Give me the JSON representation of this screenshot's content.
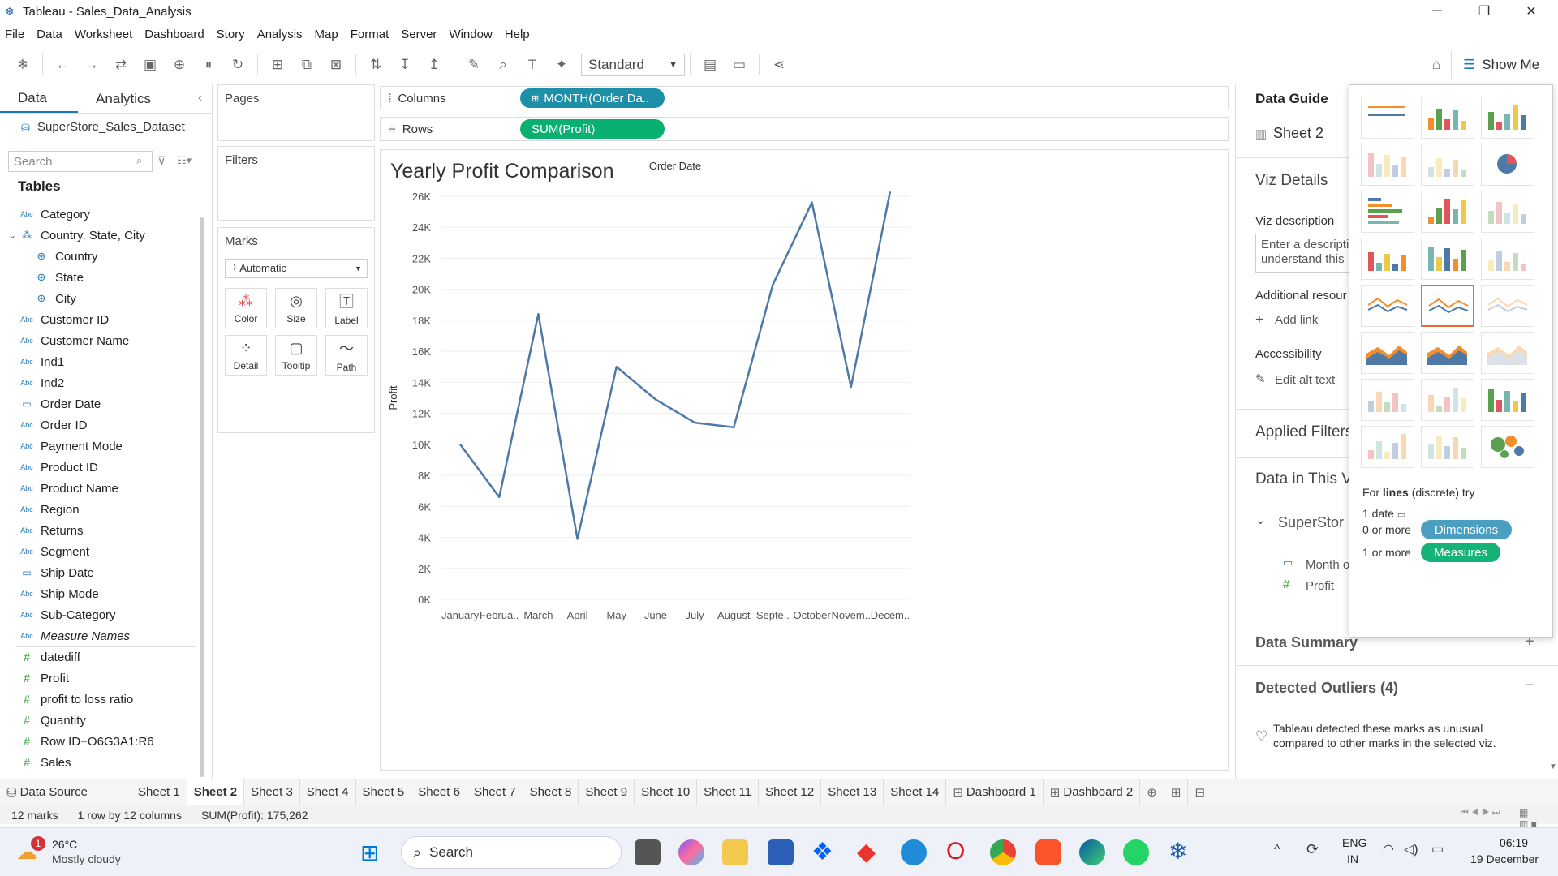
{
  "window": {
    "title": "Tableau - Sales_Data_Analysis",
    "minimize": "─",
    "maximize": "❐",
    "close": "✕"
  },
  "menu": [
    "File",
    "Data",
    "Worksheet",
    "Dashboard",
    "Story",
    "Analysis",
    "Map",
    "Format",
    "Server",
    "Window",
    "Help"
  ],
  "toolbar": {
    "fit_mode": "Standard",
    "show_me_label": "Show Me"
  },
  "data_pane": {
    "tab_data": "Data",
    "tab_analytics": "Analytics",
    "datasource": "SuperStore_Sales_Dataset",
    "search_placeholder": "Search",
    "tables_heading": "Tables",
    "fields": [
      {
        "label": "Category",
        "icon": "Abc"
      },
      {
        "label": "Country, State, City",
        "icon": "hier"
      },
      {
        "label": "Country",
        "icon": "geo"
      },
      {
        "label": "State",
        "icon": "geo"
      },
      {
        "label": "City",
        "icon": "geo"
      },
      {
        "label": "Customer ID",
        "icon": "Abc"
      },
      {
        "label": "Customer Name",
        "icon": "Abc"
      },
      {
        "label": "Ind1",
        "icon": "Abc"
      },
      {
        "label": "Ind2",
        "icon": "Abc"
      },
      {
        "label": "Order Date",
        "icon": "date"
      },
      {
        "label": "Order ID",
        "icon": "Abc"
      },
      {
        "label": "Payment Mode",
        "icon": "Abc"
      },
      {
        "label": "Product ID",
        "icon": "Abc"
      },
      {
        "label": "Product Name",
        "icon": "Abc"
      },
      {
        "label": "Region",
        "icon": "Abc"
      },
      {
        "label": "Returns",
        "icon": "Abc"
      },
      {
        "label": "Segment",
        "icon": "Abc"
      },
      {
        "label": "Ship Date",
        "icon": "date"
      },
      {
        "label": "Ship Mode",
        "icon": "Abc"
      },
      {
        "label": "Sub-Category",
        "icon": "Abc"
      },
      {
        "label": "Measure Names",
        "icon": "Abc"
      },
      {
        "label": "datediff",
        "icon": "#"
      },
      {
        "label": "Profit",
        "icon": "#"
      },
      {
        "label": "profit to loss ratio",
        "icon": "#"
      },
      {
        "label": "Quantity",
        "icon": "#"
      },
      {
        "label": "Row ID+O6G3A1:R6",
        "icon": "#"
      },
      {
        "label": "Sales",
        "icon": "#"
      }
    ]
  },
  "cards": {
    "pages": "Pages",
    "filters": "Filters",
    "marks": "Marks",
    "marks_type": "Automatic",
    "mark_buttons": [
      "Color",
      "Size",
      "Label",
      "Detail",
      "Tooltip",
      "Path"
    ]
  },
  "shelves": {
    "columns_label": "Columns",
    "columns_pill": "MONTH(Order Da..",
    "rows_label": "Rows",
    "rows_pill": "SUM(Profit)"
  },
  "viz": {
    "title": "Yearly Profit Comparison",
    "x_header": "Order Date",
    "y_label": "Profit"
  },
  "chart_data": {
    "type": "line",
    "title": "Yearly Profit Comparison",
    "xlabel": "Order Date",
    "ylabel": "Profit",
    "categories": [
      "January",
      "Februa..",
      "March",
      "April",
      "May",
      "June",
      "July",
      "August",
      "Septe..",
      "October",
      "Novem..",
      "Decem.."
    ],
    "y_ticks": [
      "0K",
      "2K",
      "4K",
      "6K",
      "8K",
      "10K",
      "12K",
      "14K",
      "16K",
      "18K",
      "20K",
      "22K",
      "24K",
      "26K"
    ],
    "ylim": [
      0,
      26000
    ],
    "series": [
      {
        "values": [
          10000,
          6600,
          18400,
          3900,
          15000,
          12900,
          11400,
          11100,
          20300,
          25600,
          13700,
          26300
        ]
      }
    ],
    "color": "#4e79a7"
  },
  "guide": {
    "title": "Data Guide",
    "sheet": "Sheet 2",
    "viz_details": "Viz Details",
    "viz_description": "Viz description",
    "desc_placeholder_1": "Enter a descripti",
    "desc_placeholder_2": "understand this",
    "additional_resources": "Additional resour",
    "add_link": "Add link",
    "accessibility": "Accessibility",
    "edit_alt_text": "Edit alt text",
    "applied_filters": "Applied Filters",
    "data_in_viz": "Data in This Vi",
    "datasource_short": "SuperStor",
    "field_month": "Month o",
    "field_profit": "Profit",
    "data_summary": "Data Summary",
    "detected_outliers": "Detected Outliers (4)",
    "outlier_text_1": "Tableau detected these marks as unusual",
    "outlier_text_2": "compared to other marks in the selected viz."
  },
  "showme": {
    "hint_prefix": "For",
    "hint_bold": "lines",
    "hint_suffix": "(discrete) try",
    "req_date": "1 date",
    "req_dim_prefix": "0 or more",
    "req_dim": "Dimensions",
    "req_mea_prefix": "1 or more",
    "req_mea": "Measures",
    "colors": {
      "dimension": "#4a9fc1",
      "measure": "#14b37a",
      "selected": "#e86a2f"
    }
  },
  "sheet_tabs": [
    "Data Source",
    "Sheet 1",
    "Sheet 2",
    "Sheet 3",
    "Sheet 4",
    "Sheet 5",
    "Sheet 6",
    "Sheet 7",
    "Sheet 8",
    "Sheet 9",
    "Sheet 10",
    "Sheet 11",
    "Sheet 12",
    "Sheet 13",
    "Sheet 14",
    "Dashboard 1",
    "Dashboard 2"
  ],
  "status": {
    "marks": "12 marks",
    "shape": "1 row by 12 columns",
    "sum": "SUM(Profit): 175,262"
  },
  "taskbar": {
    "weather_temp": "26°C",
    "weather_desc": "Mostly cloudy",
    "weather_badge": "1",
    "search": "Search",
    "lang_1": "ENG",
    "lang_2": "IN",
    "time": "06:19",
    "date": "19 December"
  }
}
